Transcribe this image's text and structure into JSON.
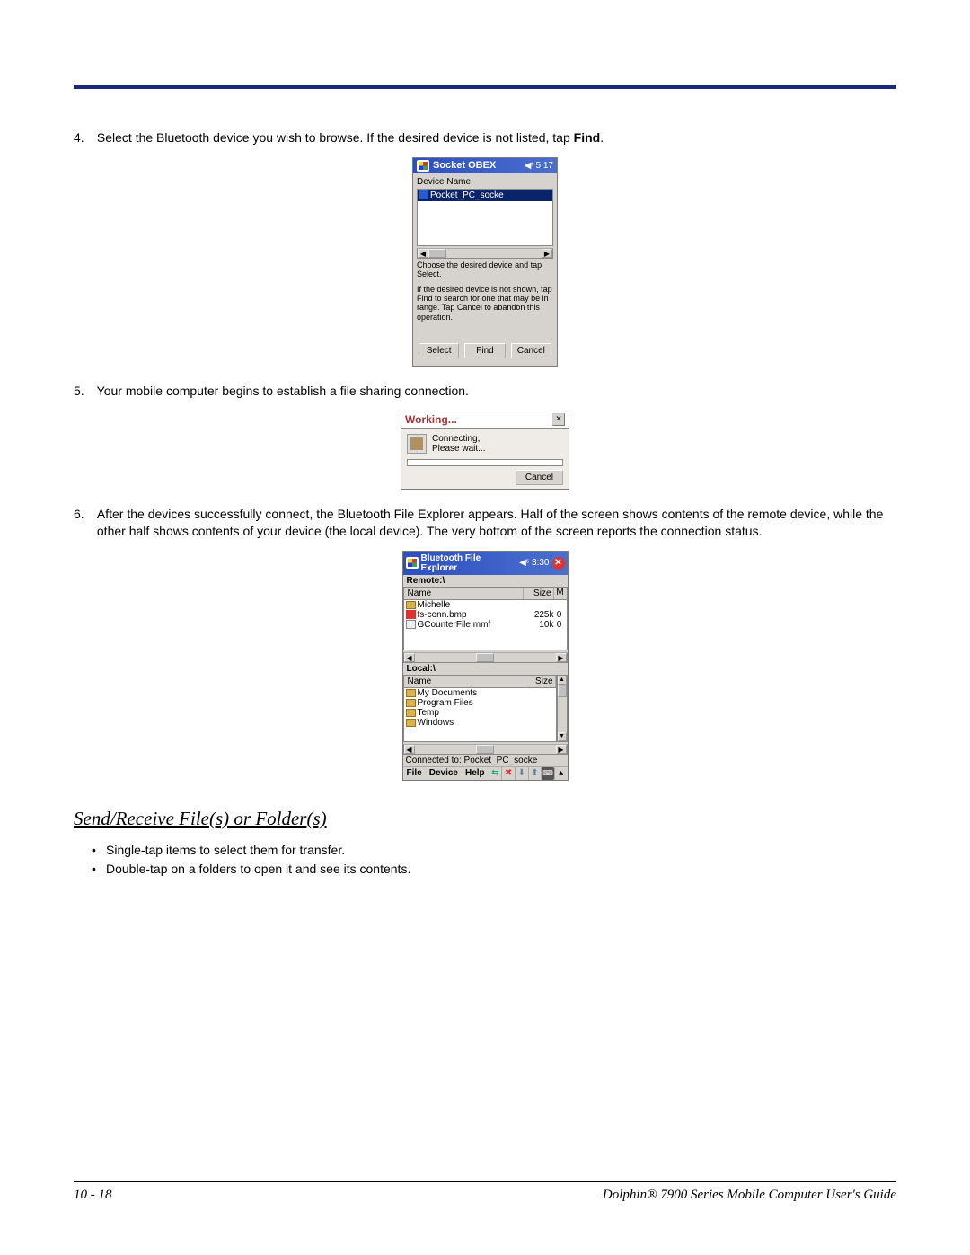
{
  "steps": {
    "s4_num": "4.",
    "s4_pre": "Select the Bluetooth device you wish to browse. If the desired device is not listed, tap ",
    "s4_bold": "Find",
    "s4_post": ".",
    "s5_num": "5.",
    "s5_text": "Your mobile computer begins to establish a file sharing connection.",
    "s6_num": "6.",
    "s6_text": "After the devices successfully connect, the Bluetooth File Explorer appears. Half of the screen shows contents of the remote device, while the other half shows contents of your device (the local device). The very bottom of the screen reports the connection status."
  },
  "fig1": {
    "title": "Socket OBEX",
    "time": "5:17",
    "dev_label": "Device Name",
    "device": "Pocket_PC_socke",
    "note_a": "Choose the desired device and tap Select.",
    "note_b": "If the desired device is not shown, tap Find to search for one that may be in range. Tap Cancel to abandon this operation.",
    "btn_select": "Select",
    "btn_find": "Find",
    "btn_cancel": "Cancel"
  },
  "fig2": {
    "title": "Working...",
    "line1": "Connecting,",
    "line2": "Please wait...",
    "btn_cancel": "Cancel"
  },
  "fig3": {
    "title": "Bluetooth File Explorer",
    "time": "3:30",
    "remote_label": "Remote:\\",
    "local_label": "Local:\\",
    "col_name": "Name",
    "col_size": "Size",
    "col_m": "M",
    "remote_rows": [
      {
        "name": "Michelle",
        "size": "",
        "type": "folder",
        "m": ""
      },
      {
        "name": "fs-conn.bmp",
        "size": "225k",
        "type": "bmp",
        "m": "0"
      },
      {
        "name": "GCounterFile.mmf",
        "size": "10k",
        "type": "mmf",
        "m": "0"
      }
    ],
    "local_rows": [
      {
        "name": "My Documents",
        "type": "folder"
      },
      {
        "name": "Program Files",
        "type": "folder"
      },
      {
        "name": "Temp",
        "type": "folder"
      },
      {
        "name": "Windows",
        "type": "folder"
      }
    ],
    "status": "Connected to: Pocket_PC_socke",
    "menu_file": "File",
    "menu_device": "Device",
    "menu_help": "Help"
  },
  "section": {
    "heading": "Send/Receive File(s) or Folder(s)",
    "b1": "Single-tap items to select them for transfer.",
    "b2": "Double-tap on a folders to open it and see its contents."
  },
  "footer": {
    "left": "10 - 18",
    "right": "Dolphin® 7900 Series Mobile Computer User's Guide"
  }
}
